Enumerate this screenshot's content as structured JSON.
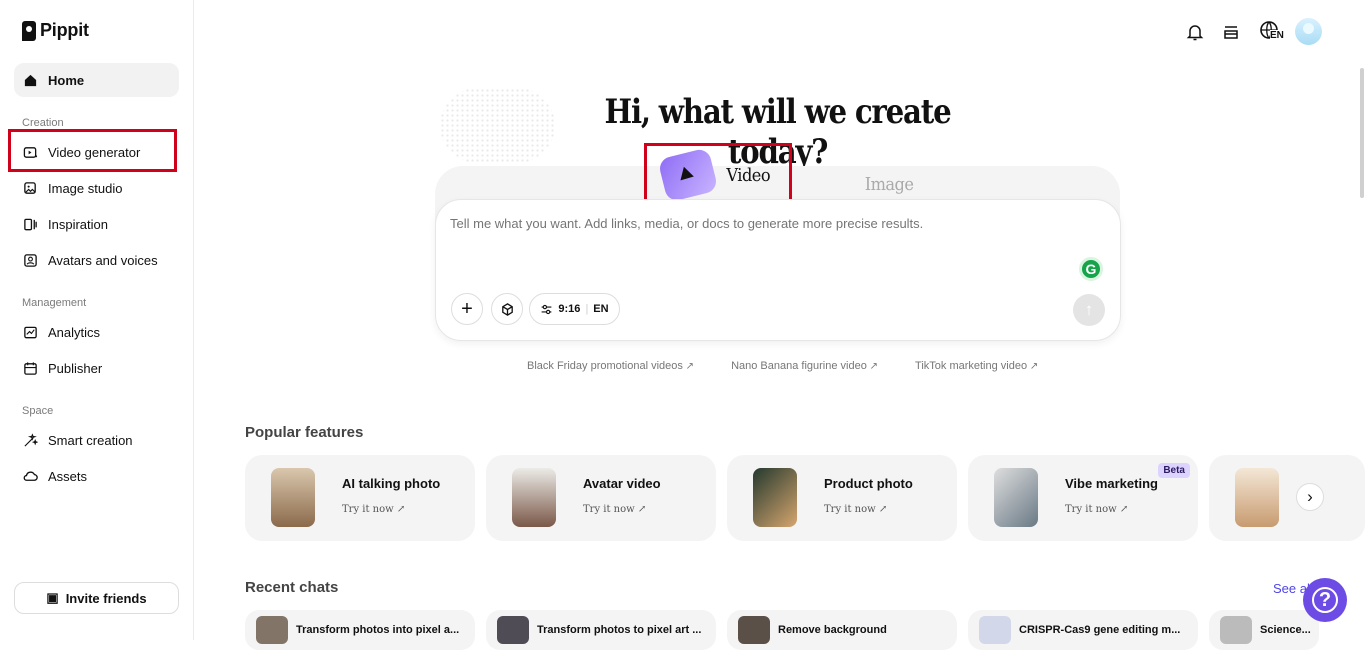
{
  "brand": {
    "name": "Pippit"
  },
  "sidebar": {
    "home": "Home",
    "creation_label": "Creation",
    "creation_items": [
      "Video generator",
      "Image studio",
      "Inspiration",
      "Avatars and voices"
    ],
    "management_label": "Management",
    "management_items": [
      "Analytics",
      "Publisher"
    ],
    "space_label": "Space",
    "space_items": [
      "Smart creation",
      "Assets"
    ],
    "invite": "Invite friends"
  },
  "topbar": {
    "language": "EN"
  },
  "hero": {
    "headline": "Hi, what will we create today?"
  },
  "tabs": {
    "video": "Video",
    "image": "Image"
  },
  "composer": {
    "placeholder": "Tell me what you want. Add links, media, or docs to generate more precise results.",
    "ratio": "9:16",
    "language": "EN",
    "assistant_badge": "G"
  },
  "suggestions": [
    "Black Friday promotional videos",
    "Nano Banana figurine video",
    "TikTok marketing video"
  ],
  "popular": {
    "title": "Popular features",
    "cards": [
      {
        "title": "AI talking photo",
        "subtitle": "Try it now ↗"
      },
      {
        "title": "Avatar video",
        "subtitle": "Try it now ↗"
      },
      {
        "title": "Product photo",
        "subtitle": "Try it now ↗"
      },
      {
        "title": "Vibe marketing",
        "subtitle": "Try it now ↗",
        "badge": "Beta"
      }
    ]
  },
  "recent": {
    "title": "Recent chats",
    "see_all": "See all",
    "items": [
      "Transform photos into pixel a...",
      "Transform photos to pixel art ...",
      "Remove background",
      "CRISPR-Cas9 gene editing m...",
      "Science..."
    ]
  },
  "colors": {
    "accent": "#6c4ce4",
    "highlight": "#d0021b"
  },
  "icons": [
    "home-icon",
    "video-generator-icon",
    "image-studio-icon",
    "inspiration-icon",
    "avatar-icon",
    "analytics-icon",
    "publisher-icon",
    "smart-creation-icon",
    "assets-icon",
    "bell-icon",
    "inbox-icon",
    "globe-icon",
    "plus-icon",
    "cube-icon",
    "sliders-icon",
    "send-icon",
    "chevron-right-icon",
    "help-icon"
  ]
}
